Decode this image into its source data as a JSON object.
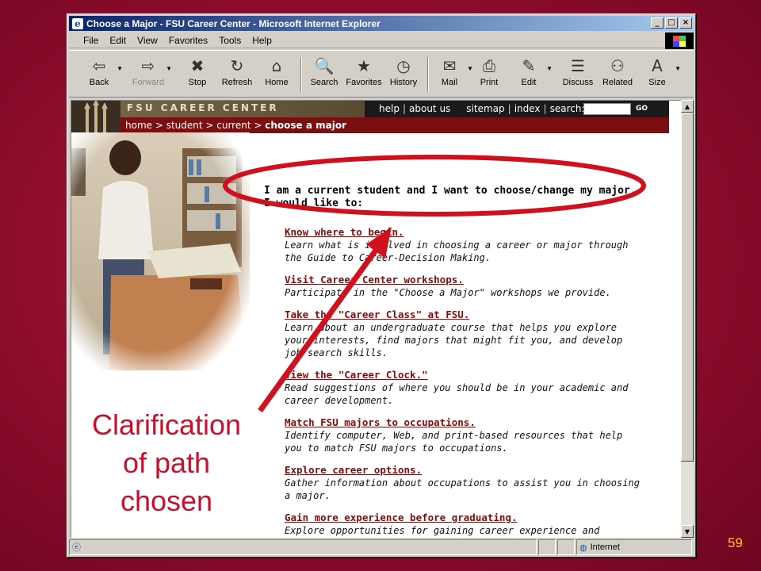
{
  "window": {
    "title": "Choose a Major - FSU Career Center - Microsoft Internet Explorer",
    "controls": {
      "minimize": "_",
      "maximize": "□",
      "close": "×"
    }
  },
  "menu": [
    "File",
    "Edit",
    "View",
    "Favorites",
    "Tools",
    "Help"
  ],
  "toolbar": [
    {
      "label": "Back",
      "icon": "back-arrow-icon",
      "glyph": "⇦"
    },
    {
      "label": "Forward",
      "icon": "forward-arrow-icon",
      "glyph": "⇨"
    },
    {
      "label": "Stop",
      "icon": "stop-icon",
      "glyph": "✖"
    },
    {
      "label": "Refresh",
      "icon": "refresh-icon",
      "glyph": "↻"
    },
    {
      "label": "Home",
      "icon": "home-icon",
      "glyph": "⌂"
    },
    {
      "label": "Search",
      "icon": "search-icon",
      "glyph": "🔍"
    },
    {
      "label": "Favorites",
      "icon": "favorites-icon",
      "glyph": "★"
    },
    {
      "label": "History",
      "icon": "history-icon",
      "glyph": "◷"
    },
    {
      "label": "Mail",
      "icon": "mail-icon",
      "glyph": "✉"
    },
    {
      "label": "Print",
      "icon": "print-icon",
      "glyph": "⎙"
    },
    {
      "label": "Edit",
      "icon": "edit-icon",
      "glyph": "✎"
    },
    {
      "label": "Discuss",
      "icon": "discuss-icon",
      "glyph": "☰"
    },
    {
      "label": "Related",
      "icon": "related-icon",
      "glyph": "⚇"
    },
    {
      "label": "Size",
      "icon": "size-icon",
      "glyph": "A"
    }
  ],
  "page": {
    "brand": "FSU CAREER CENTER",
    "nav": {
      "help": "help",
      "about": "about us",
      "sitemap": "sitemap",
      "index": "index",
      "search_label": "search:",
      "go": "GO",
      "sep": "|"
    },
    "breadcrumb": {
      "trail": "home > student > current > ",
      "current": "choose a major"
    },
    "heading": {
      "line1": "I am a current student and I want to choose/change my major.",
      "line2": "I would like to:"
    },
    "items": [
      {
        "title": "Know where to begin.",
        "desc": "Learn what is involved in choosing a career or major through the Guide to Career-Decision Making."
      },
      {
        "title": "Visit Career Center workshops.",
        "desc": "Participate in the \"Choose a Major\" workshops we provide."
      },
      {
        "title": "Take the \"Career Class\" at FSU.",
        "desc": "Learn about an undergraduate course that helps you explore your interests, find majors that might fit you, and develop job search skills."
      },
      {
        "title": "View the \"Career Clock.\"",
        "desc": "Read suggestions of where you should be in your academic and career development."
      },
      {
        "title": "Match FSU majors to occupations.",
        "desc": "Identify computer, Web, and print-based resources that help you to match FSU majors to occupations."
      },
      {
        "title": "Explore career options.",
        "desc": "Gather information about occupations to assist you in choosing a major."
      },
      {
        "title": "Gain more experience before graduating.",
        "desc": "Explore opportunities for gaining career experience and discover how to get involved."
      }
    ]
  },
  "status": {
    "zone": "Internet"
  },
  "slide": {
    "callout_lines": [
      "Clarification",
      "of path",
      "chosen"
    ],
    "number": "59"
  },
  "colors": {
    "annotation": "#d0101c",
    "crimson": "#7b0f0f",
    "slide_bg": "#8e0c2c"
  }
}
